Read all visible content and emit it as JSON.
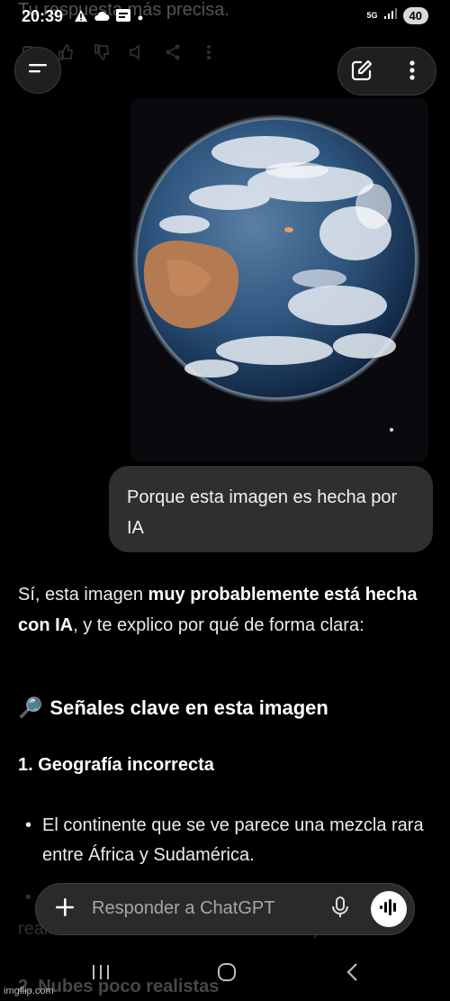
{
  "status_bar": {
    "time": "20:39",
    "network": "5G",
    "battery": "40"
  },
  "background_text": "Tu respuesta más precisa.",
  "top_bar": {
    "menu_icon": "menu-icon",
    "edit_icon": "edit-icon",
    "more_icon": "more-vertical-icon"
  },
  "user_message": {
    "text": "Porque esta imagen es hecha por IA"
  },
  "assistant": {
    "intro_1": "Sí, esta imagen ",
    "intro_bold": "muy probablemente está hecha con IA",
    "intro_2": ", y te explico por qué de forma clara:",
    "section_emoji": "🔎",
    "section_title": "Señales clave en esta imagen",
    "point_1_title": "1. Geografía incorrecta",
    "bullet_1": "El continente que se ve parece una mezcla rara entre África y Sudamérica.",
    "hidden_line": "realmente se ve la Tierra desde el espacio.",
    "point_2_title": "2. Nubes poco realistas"
  },
  "composer": {
    "placeholder": "Responder a ChatGPT",
    "plus_icon": "plus-icon",
    "mic_icon": "mic-icon",
    "voice_icon": "voice-mode-icon"
  },
  "watermark": "imgflip.com",
  "colors": {
    "background": "#000000",
    "bubble": "#2f2f2f",
    "composer": "#2a2a2a",
    "text": "#ececec"
  }
}
